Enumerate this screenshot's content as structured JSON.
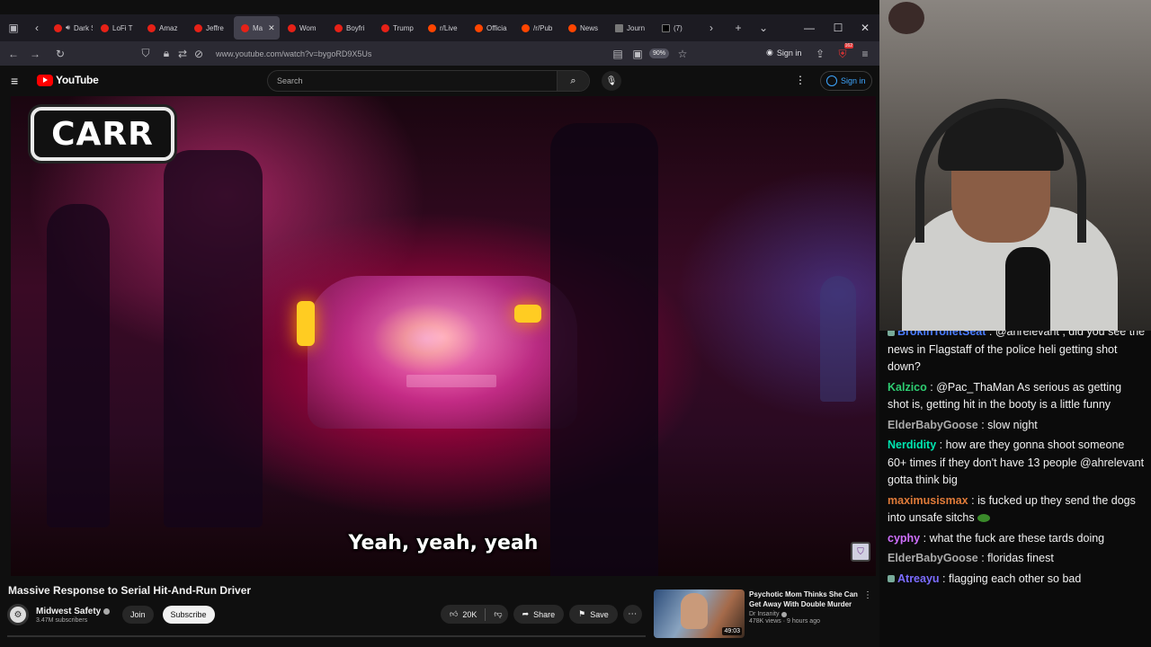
{
  "browser": {
    "tabs": [
      {
        "label": "Dark S",
        "favicon": "youtube",
        "audio": true,
        "active": false
      },
      {
        "label": "LoFi T",
        "favicon": "youtube",
        "active": false
      },
      {
        "label": "Amaz",
        "favicon": "youtube",
        "active": false
      },
      {
        "label": "Jeffre",
        "favicon": "youtube",
        "active": false
      },
      {
        "label": "Ma",
        "favicon": "youtube",
        "active": true
      },
      {
        "label": "Wom",
        "favicon": "youtube",
        "active": false
      },
      {
        "label": "Boyfri",
        "favicon": "youtube",
        "active": false
      },
      {
        "label": "Trump",
        "favicon": "youtube",
        "active": false
      },
      {
        "label": "r/Live",
        "favicon": "reddit",
        "active": false
      },
      {
        "label": "Officia",
        "favicon": "reddit",
        "active": false
      },
      {
        "label": "/r/Pub",
        "favicon": "reddit",
        "active": false
      },
      {
        "label": "News",
        "favicon": "reddit",
        "active": false
      },
      {
        "label": "Journ",
        "favicon": "journ",
        "active": false
      },
      {
        "label": "(7)",
        "favicon": "x",
        "active": false
      }
    ],
    "url": "www.youtube.com/watch?v=bygoRD9X5Us",
    "zoom": "90%",
    "signin_label": "Sign in",
    "extension_badge": "162"
  },
  "youtube": {
    "logo_text": "YouTube",
    "search_placeholder": "Search",
    "signin_label": "Sign in",
    "accent_color": "#ff0000"
  },
  "video": {
    "overlay_logo": "CARR",
    "subtitle": "Yeah, yeah, yeah",
    "title": "Massive Response to Serial Hit-And-Run Driver",
    "channel": "Midwest Safety",
    "subscribers": "3.47M subscribers",
    "join_label": "Join",
    "subscribe_label": "Subscribe",
    "likes": "20K",
    "share_label": "Share",
    "save_label": "Save"
  },
  "recommendation": {
    "title": "Psychotic Mom Thinks She Can Get Away With Double Murder",
    "channel": "Dr Insanity",
    "stats": "478K views · 9 hours ago",
    "duration": "49:03"
  },
  "chat": {
    "messages": [
      {
        "user": "BrokinToiletSeat",
        "color": "#4a7cff",
        "text": "@ahrelevant , did you see the news in Flagstaff of the police heli getting shot down?",
        "badge": true
      },
      {
        "user": "Kalzico",
        "color": "#2ecc71",
        "text": "@Pac_ThaMan As serious as getting shot is, getting hit in the booty is a little funny"
      },
      {
        "user": "ElderBabyGoose",
        "color": "#aaaaaa",
        "text": "slow night"
      },
      {
        "user": "Nerdidity",
        "color": "#00e5b0",
        "text": "how are they gonna shoot someone 60+ times if they don't have 13 people @ahrelevant gotta think big"
      },
      {
        "user": "maximusismax",
        "color": "#e07b39",
        "text": "is fucked up they send the dogs into unsafe sitchs",
        "emote": true
      },
      {
        "user": "cyphy",
        "color": "#d070ff",
        "text": "what the fuck are these tards doing"
      },
      {
        "user": "ElderBabyGoose",
        "color": "#aaaaaa",
        "text": "floridas finest"
      },
      {
        "user": "Atreayu",
        "color": "#7b6cff",
        "text": "flagging each other so bad",
        "badge": true
      }
    ]
  }
}
